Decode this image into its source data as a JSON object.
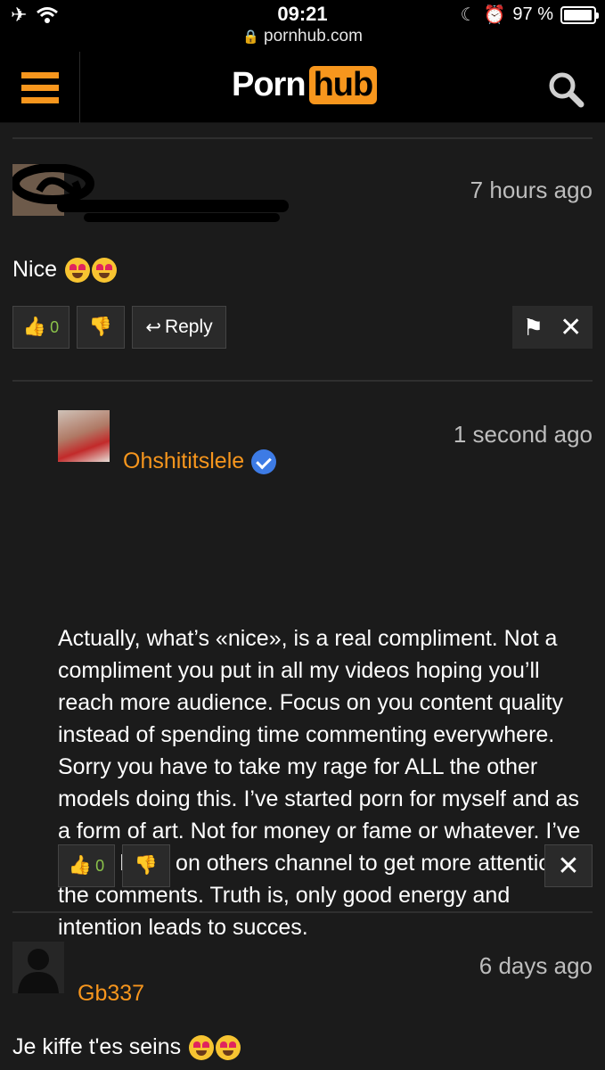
{
  "status_bar": {
    "time": "09:21",
    "url": "pornhub.com",
    "battery": "97 %",
    "battery_level": 0.97
  },
  "header": {
    "logo_left": "Porn",
    "logo_right": "hub",
    "accent": "#f7961d"
  },
  "comments": [
    {
      "time": "7 hours ago",
      "text": "Nice",
      "likes": "0",
      "reply_label": "Reply"
    },
    {
      "username": "Ohshititslele",
      "time": "1 second ago",
      "text": "Actually, what’s «nice», is a real compliment. Not a compliment you put in all my videos hoping you’ll reach more audience. Focus on you content quality instead of spending time commenting everywhere. Sorry you have to take my rage for ALL the other models doing this. I’ve started porn for myself and as a form of art. Not for money or fame or whatever. I’ve never been on others channel to get more attention in the comments. Truth is, only good energy and intention leads to succes.",
      "likes": "0"
    },
    {
      "username": "Gb337",
      "time": "6 days ago",
      "text": "Je kiffe t'es seins"
    }
  ]
}
